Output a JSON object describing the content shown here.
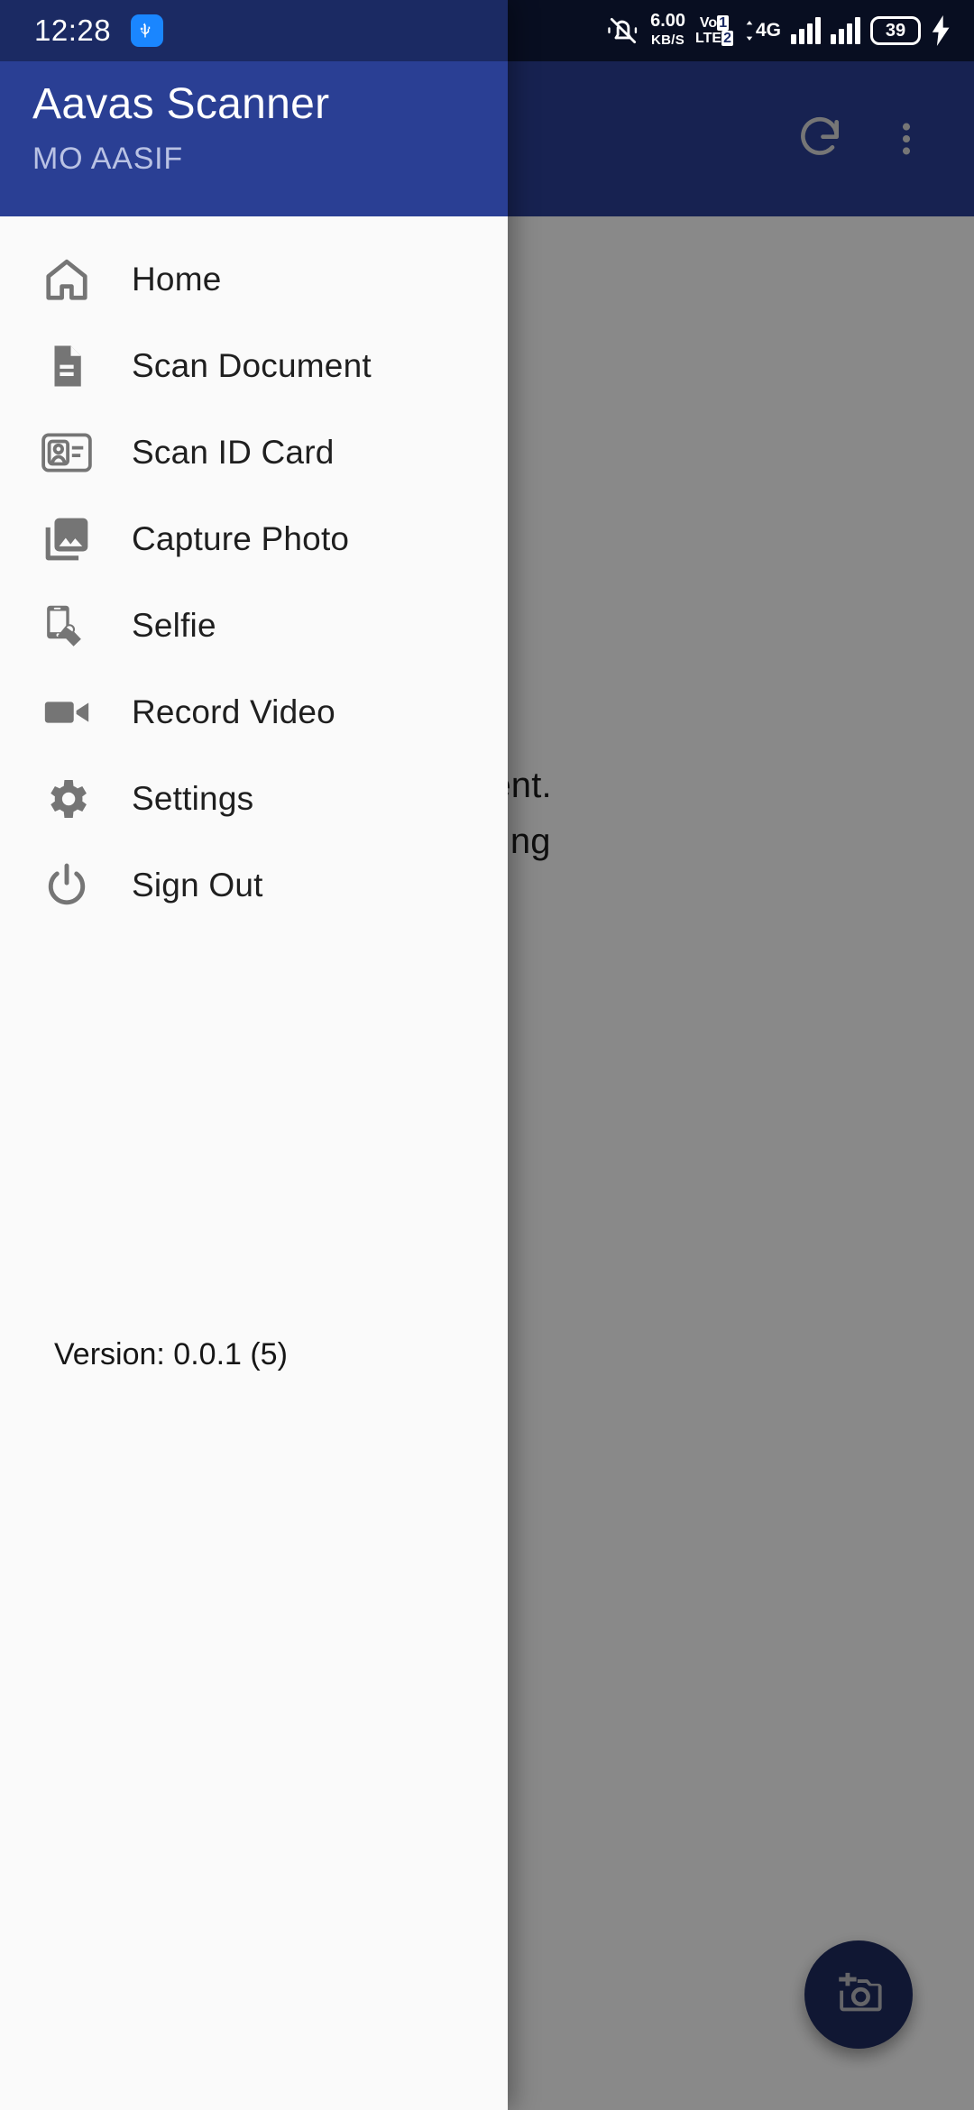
{
  "status_bar": {
    "time": "12:28",
    "usb_icon": "usb-icon",
    "silent_icon": "bell-muted-icon",
    "net_speed_value": "6.00",
    "net_speed_unit": "KB/S",
    "volte_top": "Vo",
    "volte_bottom": "LTE",
    "volte_sim": "1",
    "volte_sim2": "2",
    "network_type": "4G",
    "battery_level": "39",
    "charging_icon": "charging-bolt-icon"
  },
  "toolbar": {
    "refresh_icon": "refresh-icon",
    "overflow_icon": "more-vertical-icon"
  },
  "drawer": {
    "title": "Aavas Scanner",
    "subtitle": "MO AASIF",
    "items": [
      {
        "label": "Home",
        "icon": "home-icon"
      },
      {
        "label": "Scan Document",
        "icon": "document-icon"
      },
      {
        "label": "Scan ID Card",
        "icon": "id-card-icon"
      },
      {
        "label": "Capture Photo",
        "icon": "photo-library-icon"
      },
      {
        "label": "Selfie",
        "icon": "hand-phone-icon"
      },
      {
        "label": "Record Video",
        "icon": "video-camera-icon"
      },
      {
        "label": "Settings",
        "icon": "gear-icon"
      },
      {
        "label": "Sign Out",
        "icon": "power-icon"
      }
    ],
    "version": "Version: 0.0.1 (5)"
  },
  "app_content": {
    "line1": "cument.",
    "line2": "canning",
    "fab_icon": "add-a-photo-icon"
  },
  "colors": {
    "drawer_header_blue": "#2a3f94",
    "status_bar_navy": "#1b2a63",
    "drawer_bg": "#fafafa",
    "fab_navy": "#1e2a5e",
    "icon_gray": "#6f6f6f",
    "accent_usb_blue": "#1a86ff"
  }
}
